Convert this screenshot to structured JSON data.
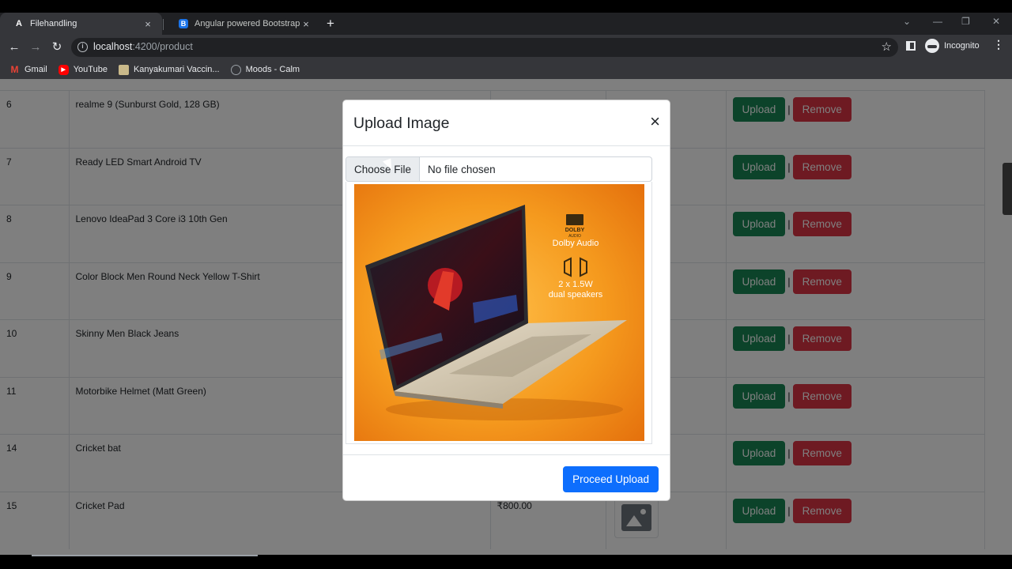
{
  "browser": {
    "tabs": [
      {
        "favicon": "A",
        "title": "Filehandling",
        "close": "×"
      },
      {
        "favicon": "B",
        "title": "Angular powered Bootstrap",
        "close": "×"
      }
    ],
    "new_tab": "+",
    "window_controls": [
      "⌄",
      "—",
      "❐",
      "✕"
    ],
    "nav": {
      "back": "←",
      "forward": "→",
      "reload": "↻"
    },
    "url_host": "localhost",
    "url_path": ":4200/product",
    "star": "☆",
    "profile_label": "Incognito",
    "menu": "⋮",
    "bookmarks": [
      {
        "icon": "gmail-icon",
        "glyph": "M",
        "label": "Gmail"
      },
      {
        "icon": "youtube-icon",
        "glyph": "▶",
        "label": "YouTube"
      },
      {
        "icon": "bookmark-site-icon",
        "glyph": "",
        "label": "Kanyakumari Vaccin..."
      },
      {
        "icon": "globe-icon",
        "glyph": "",
        "label": "Moods - Calm"
      }
    ]
  },
  "table": {
    "rows": [
      {
        "id": "6",
        "name": "realme 9 (Sunburst Gold, 128 GB)",
        "price": ""
      },
      {
        "id": "7",
        "name": "Ready LED Smart Android TV",
        "price": ""
      },
      {
        "id": "8",
        "name": "Lenovo IdeaPad 3 Core i3 10th Gen",
        "price": ""
      },
      {
        "id": "9",
        "name": "Color Block Men Round Neck Yellow T-Shirt",
        "price": ""
      },
      {
        "id": "10",
        "name": "Skinny Men Black Jeans",
        "price": ""
      },
      {
        "id": "11",
        "name": "Motorbike Helmet (Matt Green)",
        "price": ""
      },
      {
        "id": "14",
        "name": "Cricket bat",
        "price": ""
      },
      {
        "id": "15",
        "name": "Cricket Pad",
        "price": "₹800.00"
      }
    ],
    "upload_label": "Upload",
    "separator": "|",
    "remove_label": "Remove"
  },
  "modal": {
    "title": "Upload Image",
    "close": "×",
    "file_button": "Choose File",
    "file_status": "No file chosen",
    "preview": {
      "badge_brand": "DOLBY",
      "badge_sub": "AUDIO",
      "feature_1": "Dolby Audio",
      "feature_2_line1": "2 x 1.5W",
      "feature_2_line2": "dual speakers"
    },
    "submit": "Proceed Upload"
  },
  "colors": {
    "success": "#198754",
    "danger": "#dc3545",
    "primary": "#0d6efd",
    "preview_orange": "#f39a1c"
  }
}
